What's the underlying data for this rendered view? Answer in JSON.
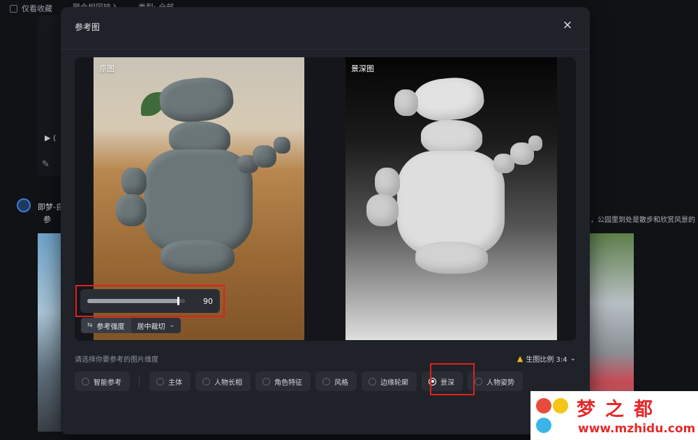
{
  "background": {
    "checkbox_label": "仅看收藏",
    "chip_1": "聚合相同输入",
    "chip_2": "类型: 全部",
    "play_label": "▶ (",
    "user_name": "即梦-自",
    "user_line2": "参",
    "right_text": "，公园里到处是散步和欣赏风景的"
  },
  "modal": {
    "title": "参考图",
    "close_icon": "×",
    "original_label": "原图",
    "depth_label": "景深图",
    "slider_value": "90",
    "slider_fraction": 0.9,
    "strength_label": "参考强度",
    "crop_label": "居中裁切",
    "dimension_hint": "请选择你要参考的图片维度",
    "ratio_label": "生图比例 3:4",
    "options": [
      {
        "label": "智能参考",
        "selected": false
      },
      {
        "label": "主体",
        "selected": false
      },
      {
        "label": "人物长相",
        "selected": false
      },
      {
        "label": "角色特征",
        "selected": false
      },
      {
        "label": "风格",
        "selected": false
      },
      {
        "label": "边缘轮廓",
        "selected": false
      },
      {
        "label": "景深",
        "selected": true
      },
      {
        "label": "人物姿势",
        "selected": false
      }
    ]
  },
  "watermark": {
    "title": "梦之都",
    "url": "www.mzhidu.com"
  },
  "colors": {
    "accent": "#17b8cf",
    "highlight": "#e02020",
    "warning": "#f0b429",
    "watermark": "#e52a2a"
  }
}
